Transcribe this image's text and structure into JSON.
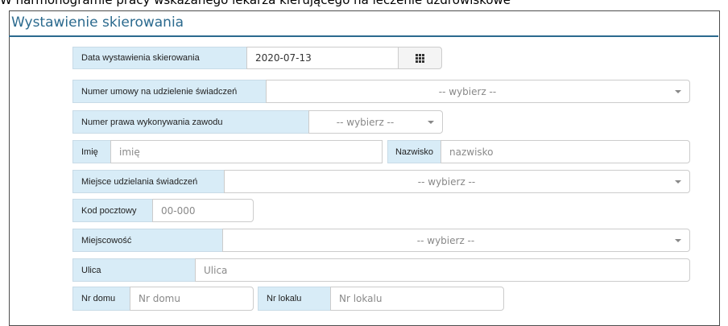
{
  "caption": "W harmonogramie pracy wskazanego lekarza kierującego na leczenie uzdrowiskowe",
  "form": {
    "title": "Wystawienie skierowania",
    "date": {
      "label": "Data wystawienia skierowania",
      "value": "2020-07-13",
      "icon": "calendar-icon"
    },
    "contract": {
      "label": "Numer umowy na udzielenie świadczeń",
      "selected": "-- wybierz --"
    },
    "license": {
      "label": "Numer prawa wykonywania zawodu",
      "selected": "-- wybierz --"
    },
    "first_name": {
      "label": "Imię",
      "placeholder": "imię"
    },
    "last_name": {
      "label": "Nazwisko",
      "placeholder": "nazwisko"
    },
    "location": {
      "label": "Miejsce udzielania świadczeń",
      "selected": "-- wybierz --"
    },
    "postal_code": {
      "label": "Kod pocztowy",
      "placeholder": "00-000"
    },
    "city": {
      "label": "Miejscowość",
      "selected": "-- wybierz --"
    },
    "street": {
      "label": "Ulica",
      "placeholder": "Ulica"
    },
    "house_no": {
      "label": "Nr domu",
      "placeholder": "Nr domu"
    },
    "flat_no": {
      "label": "Nr lokalu",
      "placeholder": "Nr lokalu"
    }
  }
}
